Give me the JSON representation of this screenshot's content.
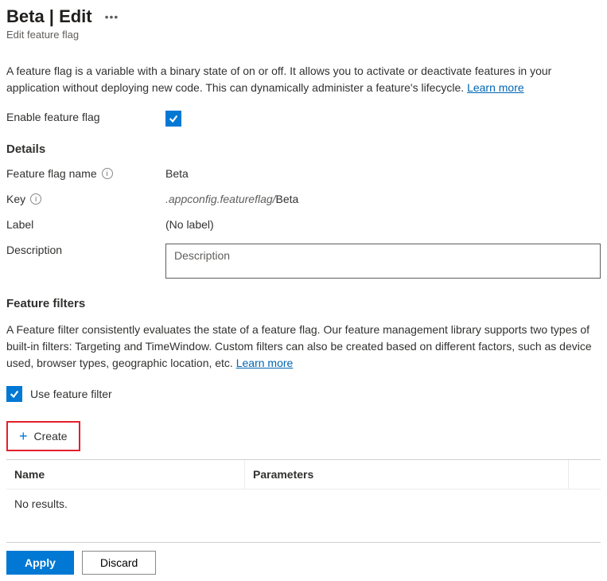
{
  "header": {
    "title": "Beta | Edit",
    "subtitle": "Edit feature flag"
  },
  "intro": {
    "text": "A feature flag is a variable with a binary state of on or off. It allows you to activate or deactivate features in your application without deploying new code. This can dynamically administer a feature's lifecycle.",
    "learn_more": "Learn more"
  },
  "fields": {
    "enable_label": "Enable feature flag",
    "enable_checked": true
  },
  "details": {
    "heading": "Details",
    "name_label": "Feature flag name",
    "name_value": "Beta",
    "key_label": "Key",
    "key_prefix": ".appconfig.featureflag/",
    "key_value": "Beta",
    "label_label": "Label",
    "label_value": "(No label)",
    "description_label": "Description",
    "description_placeholder": "Description",
    "description_value": ""
  },
  "filters": {
    "heading": "Feature filters",
    "intro": "A Feature filter consistently evaluates the state of a feature flag. Our feature management library supports two types of built-in filters: Targeting and TimeWindow. Custom filters can also be created based on different factors, such as device used, browser types, geographic location, etc.",
    "learn_more": "Learn more",
    "use_filter_label": "Use feature filter",
    "use_filter_checked": true,
    "create_label": "Create",
    "columns": {
      "name": "Name",
      "parameters": "Parameters"
    },
    "empty_text": "No results."
  },
  "footer": {
    "apply": "Apply",
    "discard": "Discard"
  }
}
